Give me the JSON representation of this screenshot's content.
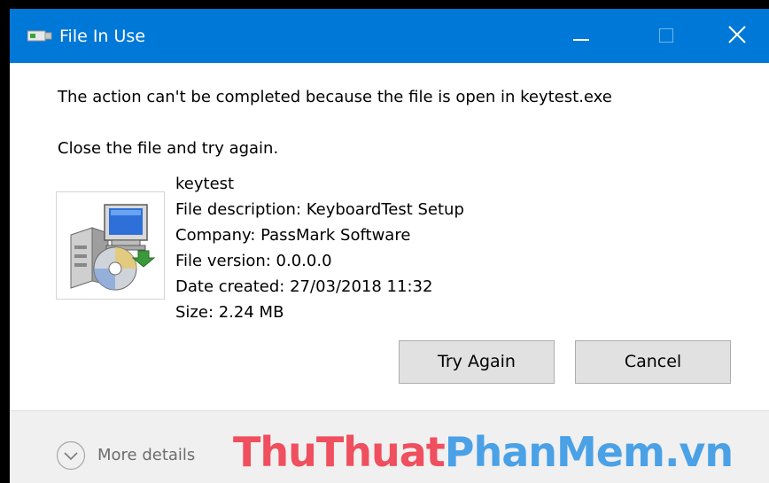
{
  "window": {
    "title": "File In Use",
    "accent_color": "#0078d7",
    "controls": {
      "minimize": "minimize-icon",
      "maximize": "maximize-icon",
      "close": "close-icon"
    }
  },
  "message": {
    "line1": "The action can't be completed because the file is open in keytest.exe",
    "line2": "Close the file and try again."
  },
  "file": {
    "icon": "setup-installer-icon",
    "name": "keytest",
    "description": "File description: KeyboardTest Setup",
    "company": "Company: PassMark Software",
    "version": "File version: 0.0.0.0",
    "date_created": "Date created: 27/03/2018 11:32",
    "size": "Size: 2.24 MB"
  },
  "buttons": {
    "try_again": "Try Again",
    "cancel": "Cancel"
  },
  "footer": {
    "more_details": "More details",
    "more_details_icon": "chevron-down-circle-icon"
  },
  "watermark": {
    "part1": "ThuThuat",
    "part2": "PhanMem.vn",
    "color1": "#ef4f5e",
    "color2": "#4aa1e6"
  }
}
